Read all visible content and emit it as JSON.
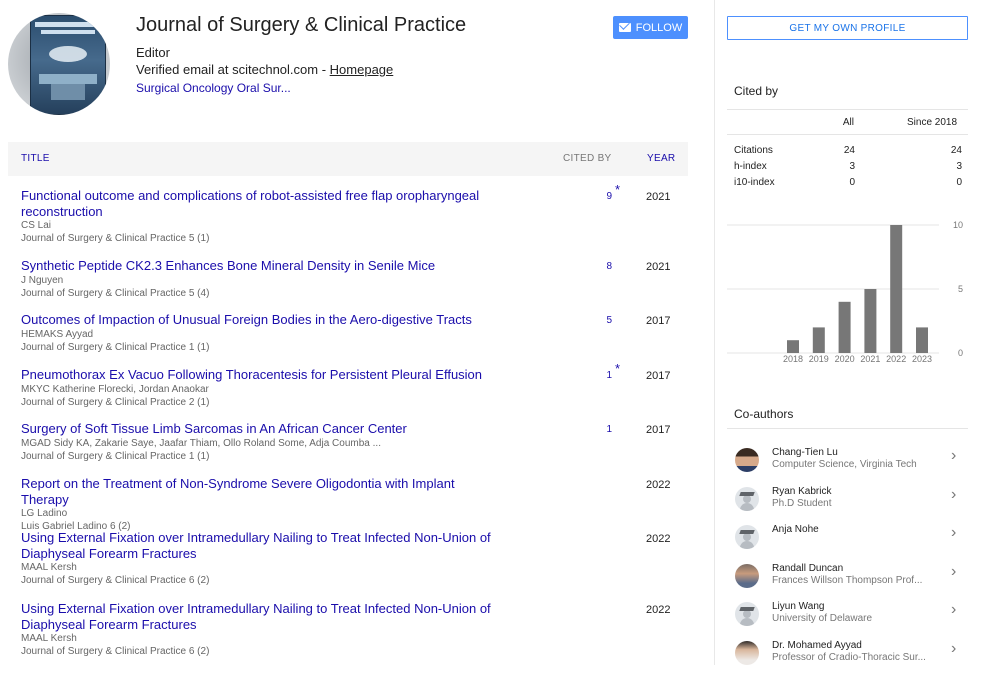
{
  "profile": {
    "name": "Journal of Surgery & Clinical Practice",
    "affiliation": "Editor",
    "email_text": "Verified email at scitechnol.com -",
    "homepage_label": "Homepage",
    "interests": "Surgical Oncology Oral Sur...",
    "follow_label": "FOLLOW",
    "avatar_cover_text": "Journal of Surgery & Clinical Practice"
  },
  "table": {
    "col_title": "TITLE",
    "col_cited": "CITED BY",
    "col_year": "YEAR"
  },
  "articles": [
    {
      "title": "Functional outcome and complications of robot-assisted free flap oropharyngeal reconstruction",
      "authors": "CS Lai",
      "venue": "Journal of Surgery & Clinical Practice 5 (1)",
      "cites": "9",
      "star": "*",
      "year": "2021"
    },
    {
      "title": "Synthetic Peptide CK2.3 Enhances Bone Mineral Density in Senile Mice",
      "authors": "J Nguyen",
      "venue": "Journal of Surgery & Clinical Practice 5 (4)",
      "cites": "8",
      "star": "",
      "year": "2021"
    },
    {
      "title": "Outcomes of Impaction of Unusual Foreign Bodies in the Aero-digestive Tracts",
      "authors": "HEMAKS Ayyad",
      "venue": "Journal of Surgery & Clinical Practice 1 (1)",
      "cites": "5",
      "star": "",
      "year": "2017"
    },
    {
      "title": "Pneumothorax Ex Vacuo Following Thoracentesis for Persistent Pleural Effusion",
      "authors": "MKYC Katherine Florecki, Jordan Anaokar",
      "venue": "Journal of Surgery & Clinical Practice 2 (1)",
      "cites": "1",
      "star": "*",
      "year": "2017"
    },
    {
      "title": "Surgery of Soft Tissue Limb Sarcomas in An African Cancer Center",
      "authors": "MGAD Sidy KA, Zakarie Saye, Jaafar Thiam, Ollo Roland Some, Adja Coumba ...",
      "venue": "Journal of Surgery & Clinical Practice 1 (1)",
      "cites": "1",
      "star": "",
      "year": "2017"
    },
    {
      "title": "Report on the Treatment of Non-Syndrome Severe Oligodontia with Implant Therapy",
      "authors": "LG Ladino",
      "venue": "Luis Gabriel Ladino 6 (2)",
      "cites": "",
      "star": "",
      "year": "2022"
    },
    {
      "title": "Using External Fixation over Intramedullary Nailing to Treat Infected Non-Union of Diaphyseal Forearm Fractures",
      "authors": "MAAL Kersh",
      "venue": "Journal of Surgery & Clinical Practice 6 (2)",
      "cites": "",
      "star": "",
      "year": "2022"
    },
    {
      "title": "Using External Fixation over Intramedullary Nailing to Treat Infected Non-Union of Diaphyseal Forearm Fractures",
      "authors": "MAAL Kersh",
      "venue": "Journal of Surgery & Clinical Practice 6 (2)",
      "cites": "",
      "star": "",
      "year": "2022"
    }
  ],
  "sidebar": {
    "own_profile_label": "GET MY OWN PROFILE",
    "cited_by_title": "Cited by",
    "col_all": "All",
    "col_since": "Since 2018",
    "metrics": [
      {
        "label": "Citations",
        "all": "24",
        "since": "24"
      },
      {
        "label": "h-index",
        "all": "3",
        "since": "3"
      },
      {
        "label": "i10-index",
        "all": "0",
        "since": "0"
      }
    ],
    "coauthors_title": "Co-authors",
    "coauthors": [
      {
        "name": "Chang-Tien Lu",
        "affiliation": "Computer Science, Virginia Tech",
        "avatar": "photo1"
      },
      {
        "name": "Ryan Kabrick",
        "affiliation": "Ph.D Student",
        "avatar": "generic"
      },
      {
        "name": "Anja Nohe",
        "affiliation": "",
        "avatar": "generic"
      },
      {
        "name": "Randall Duncan",
        "affiliation": "Frances Willson Thompson Prof...",
        "avatar": "photo2"
      },
      {
        "name": "Liyun Wang",
        "affiliation": "University of Delaware",
        "avatar": "generic"
      },
      {
        "name": "Dr. Mohamed Ayyad",
        "affiliation": "Professor of Cradio-Thoracic Sur...",
        "avatar": "photo3"
      }
    ]
  },
  "chart_data": {
    "type": "bar",
    "categories": [
      "2018",
      "2019",
      "2020",
      "2021",
      "2022",
      "2023"
    ],
    "values": [
      1,
      2,
      4,
      5,
      10,
      2
    ],
    "ylim": [
      0,
      10
    ],
    "yticks": [
      "0",
      "5",
      "10"
    ],
    "bar_color": "#777777",
    "grid": true
  }
}
